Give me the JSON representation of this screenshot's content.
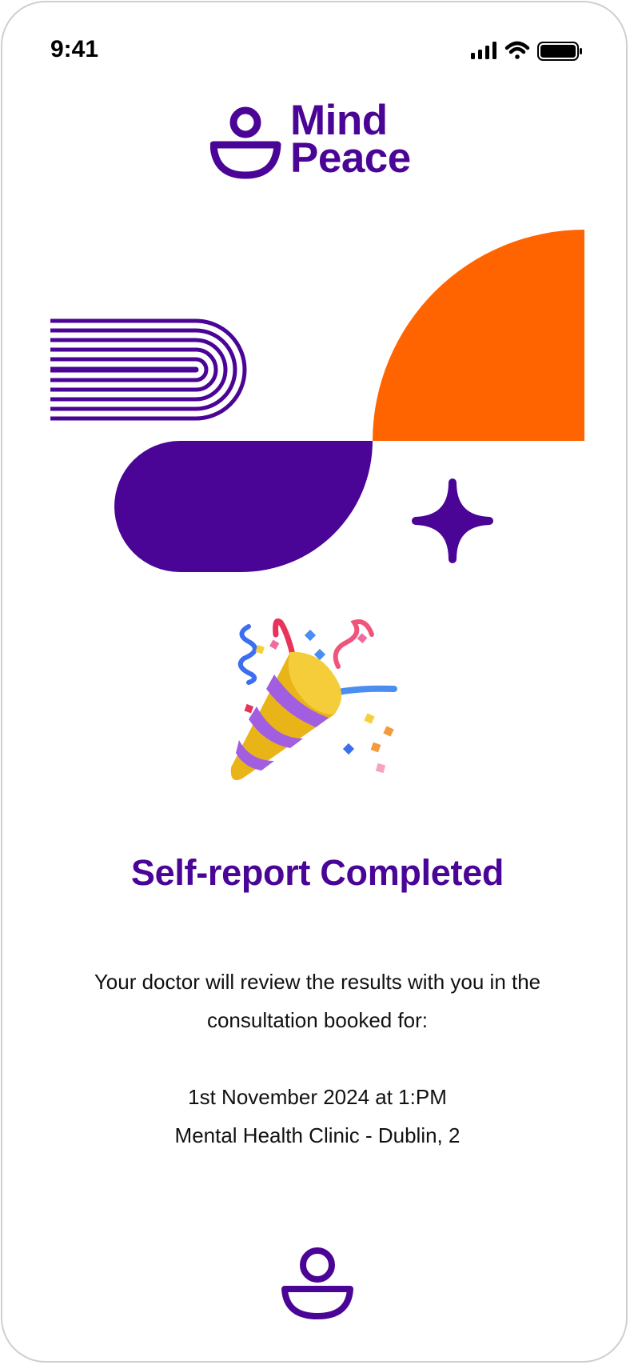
{
  "status_bar": {
    "time": "9:41"
  },
  "brand": {
    "line1": "Mind",
    "line2": "Peace"
  },
  "colors": {
    "brand_purple": "#4a0596",
    "accent_orange": "#ff6400"
  },
  "hero": {
    "emoji": "🎉"
  },
  "main": {
    "title": "Self-report Completed",
    "message": "Your doctor will review the results with you in the consultation booked for:",
    "appointment_date": "1st November 2024 at 1:PM",
    "appointment_location": "Mental Health Clinic - Dublin, 2"
  },
  "icons": [
    "signal-icon",
    "wifi-icon",
    "battery-icon",
    "mindpeace-logo-icon",
    "party-popper-icon"
  ]
}
